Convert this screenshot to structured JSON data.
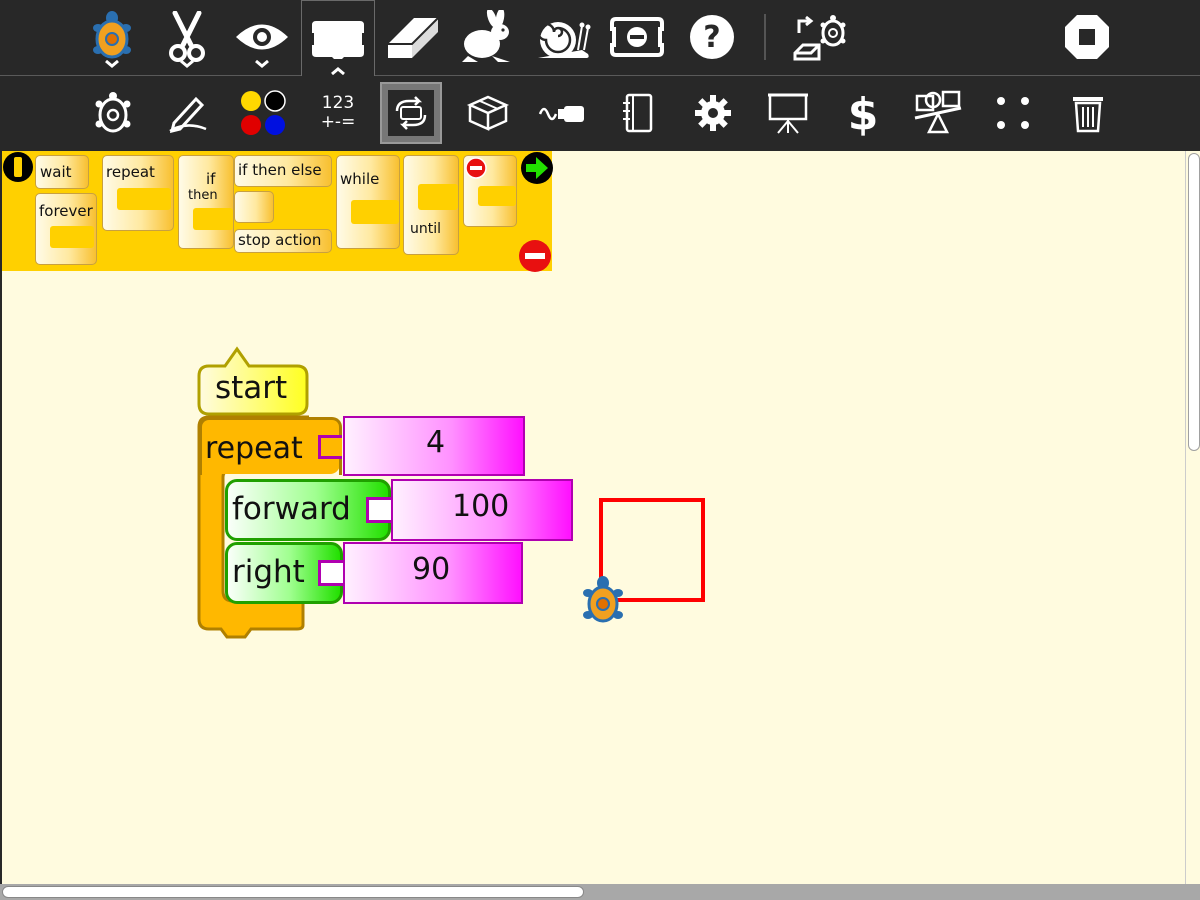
{
  "toolbar_top": {
    "buttons": [
      {
        "name": "turtle-activity-button",
        "icon": "turtle-icon"
      },
      {
        "name": "cut-button",
        "icon": "scissors-icon"
      },
      {
        "name": "view-button",
        "icon": "eye-icon"
      },
      {
        "name": "palette-toggle-button",
        "icon": "block-icon"
      },
      {
        "name": "clear-button",
        "icon": "eraser-icon"
      },
      {
        "name": "run-fast-button",
        "icon": "rabbit-icon"
      },
      {
        "name": "run-slow-button",
        "icon": "snail-icon"
      },
      {
        "name": "hide-blocks-button",
        "icon": "collapse-icon"
      },
      {
        "name": "help-button",
        "icon": "question-icon"
      },
      {
        "name": "load-example-button",
        "icon": "load-turtle-icon"
      },
      {
        "name": "stop-button",
        "icon": "stop-icon"
      }
    ]
  },
  "toolbar_palettes": {
    "number_label_1": "123",
    "number_label_2": "+-=",
    "buttons": [
      "turtle-palette",
      "pen-palette",
      "colors-palette",
      "numbers-palette",
      "flow-palette",
      "blocks-palette",
      "sensors-palette",
      "media-palette",
      "extras-palette",
      "presentation-palette",
      "portfolio-palette",
      "myblocks-palette",
      "trash-palette"
    ]
  },
  "palette_flow": {
    "wait": "wait",
    "forever": "forever",
    "repeat": "repeat",
    "if": "if",
    "then": "then",
    "if_then_else": "if then else",
    "stop_action": "stop action",
    "while": "while",
    "until": "until"
  },
  "program": {
    "start": "start",
    "repeat_label": "repeat",
    "repeat_count": "4",
    "forward_label": "forward",
    "forward_value": "100",
    "right_label": "right",
    "right_value": "90"
  },
  "colors": {
    "toolbar_bg": "#282828",
    "canvas_bg": "#fffbdf",
    "flow_yellow": "#ffd000",
    "motion_green": "#22e000",
    "number_magenta": "#ff00ff",
    "line_red": "#ff0000"
  }
}
